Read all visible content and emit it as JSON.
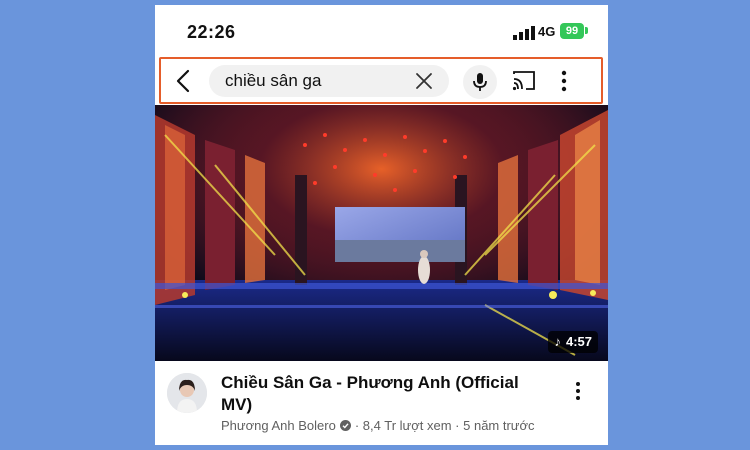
{
  "status_bar": {
    "time": "22:26",
    "network": "4G",
    "battery": "99"
  },
  "search": {
    "query": "chiều sân ga"
  },
  "video": {
    "duration": "4:57",
    "title": "Chiều Sân Ga - Phương Anh (Official MV)",
    "channel": "Phương Anh Bolero",
    "views": "8,4 Tr lượt xem",
    "age": "5 năm trước",
    "separator": "·"
  },
  "icons": [
    "back-icon",
    "clear-icon",
    "mic-icon",
    "cast-icon",
    "more-vert-icon",
    "music-note-icon",
    "verified-icon"
  ],
  "colors": {
    "page_bg": "#6a95dc",
    "highlight_border": "#e55d2a",
    "battery": "#34c759"
  }
}
